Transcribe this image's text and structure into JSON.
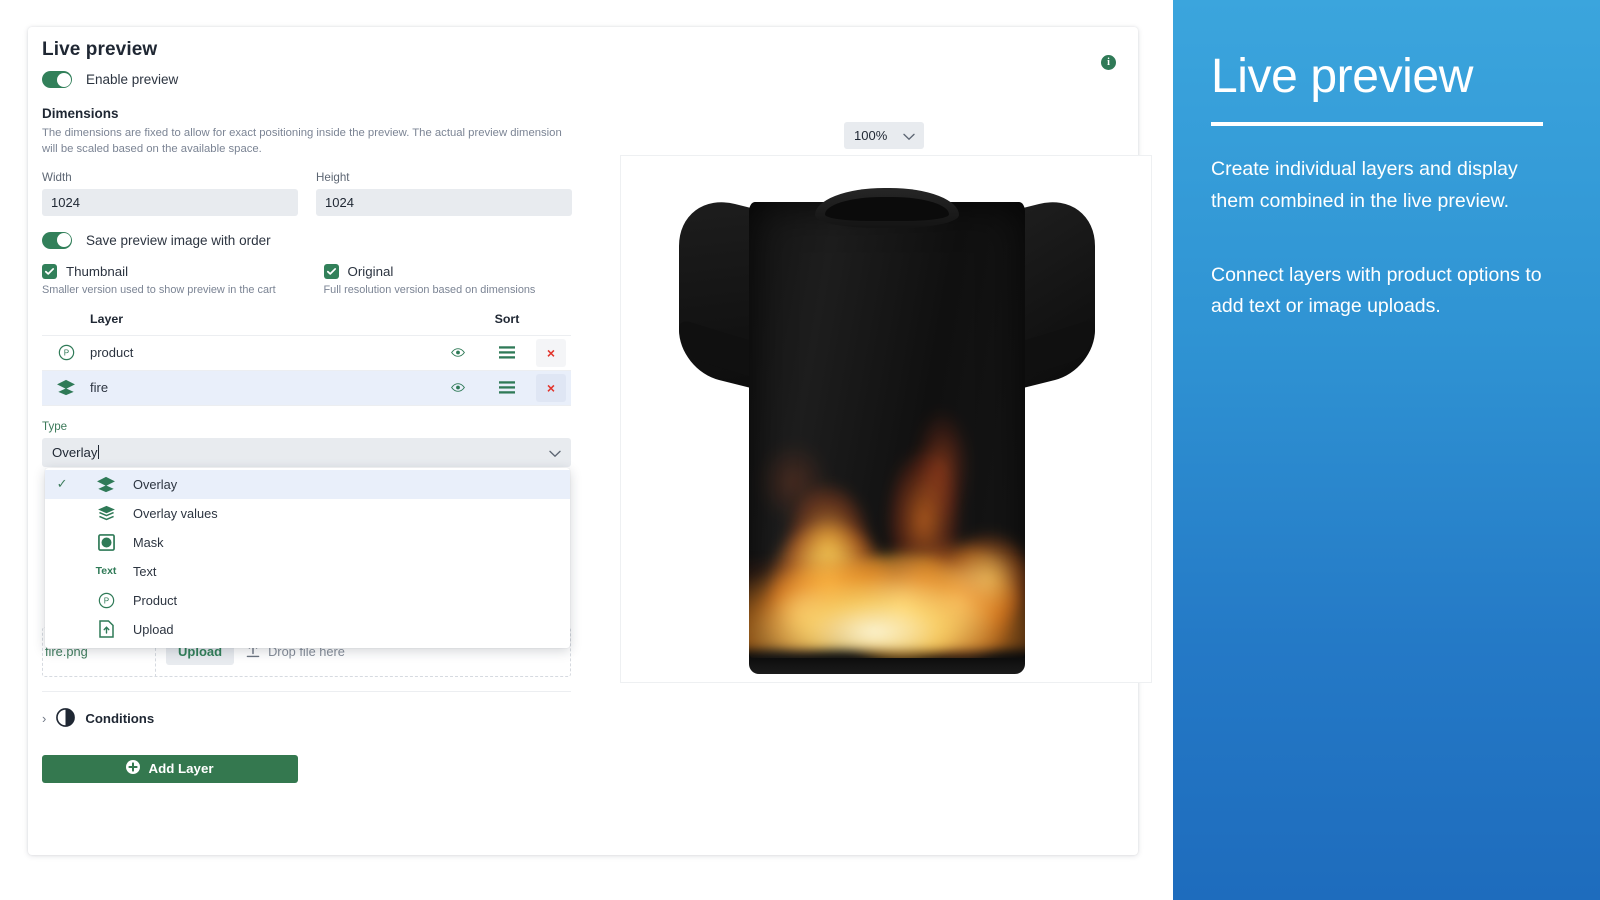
{
  "card": {
    "title": "Live preview",
    "enable_toggle_label": "Enable preview",
    "info_icon_glyph": "i",
    "dimensions": {
      "heading": "Dimensions",
      "hint": "The dimensions are fixed to allow for exact positioning inside the preview. The actual preview dimension will be scaled based on the available space.",
      "width_label": "Width",
      "width_value": "1024",
      "height_label": "Height",
      "height_value": "1024"
    },
    "save_toggle_label": "Save preview image with order",
    "thumbnail": {
      "label": "Thumbnail",
      "hint": "Smaller version used to show preview in the cart",
      "checked": true
    },
    "original": {
      "label": "Original",
      "hint": "Full resolution version based on dimensions",
      "checked": true
    },
    "layer_table": {
      "col_layer": "Layer",
      "col_sort": "Sort",
      "rows": [
        {
          "icon": "product-circle-icon",
          "name": "product",
          "eye": "eye-icon",
          "sort": "drag-handle-icon",
          "delete": "×",
          "selected": false
        },
        {
          "icon": "layers-icon",
          "name": "fire",
          "eye": "eye-icon",
          "sort": "drag-handle-icon",
          "delete": "×",
          "selected": true
        }
      ]
    },
    "type_field": {
      "label": "Type",
      "value": "Overlay"
    },
    "type_dropdown": {
      "options": [
        {
          "label": "Overlay",
          "icon": "layers-filled-icon",
          "selected": true
        },
        {
          "label": "Overlay values",
          "icon": "layers-lines-icon",
          "selected": false
        },
        {
          "label": "Mask",
          "icon": "mask-icon",
          "selected": false
        },
        {
          "label": "Text",
          "icon": "text-icon",
          "selected": false
        },
        {
          "label": "Product",
          "icon": "product-circle-icon",
          "selected": false
        },
        {
          "label": "Upload",
          "icon": "upload-file-icon",
          "selected": false
        }
      ],
      "check_glyph": "✓",
      "text_icon_glyph": "Text"
    },
    "upload_row": {
      "file_name": "fire.png",
      "upload_button": "Upload",
      "drop_text": "Drop file here"
    },
    "conditions": {
      "label": "Conditions",
      "chevron": "›",
      "icon": "contrast-icon"
    },
    "add_layer_button": {
      "label": "Add Layer",
      "icon": "plus-circle-icon"
    }
  },
  "preview": {
    "zoom_value": "100%",
    "artwork": {
      "shirt_color": "#141414",
      "layers": [
        "product",
        "fire"
      ]
    }
  },
  "promo": {
    "title": "Live preview",
    "paragraph_1": "Create individual layers and display them combined in the live preview.",
    "paragraph_2": "Connect layers with product options to add text or image uploads."
  },
  "colors": {
    "brand_green": "#32805a",
    "button_green": "#34784f",
    "selected_row_blue": "#e9effa",
    "delete_red": "#e2342b",
    "promo_blue_top": "#3ba5dd",
    "promo_blue_bottom": "#1e6cbd",
    "input_grey": "#e8ebef"
  }
}
